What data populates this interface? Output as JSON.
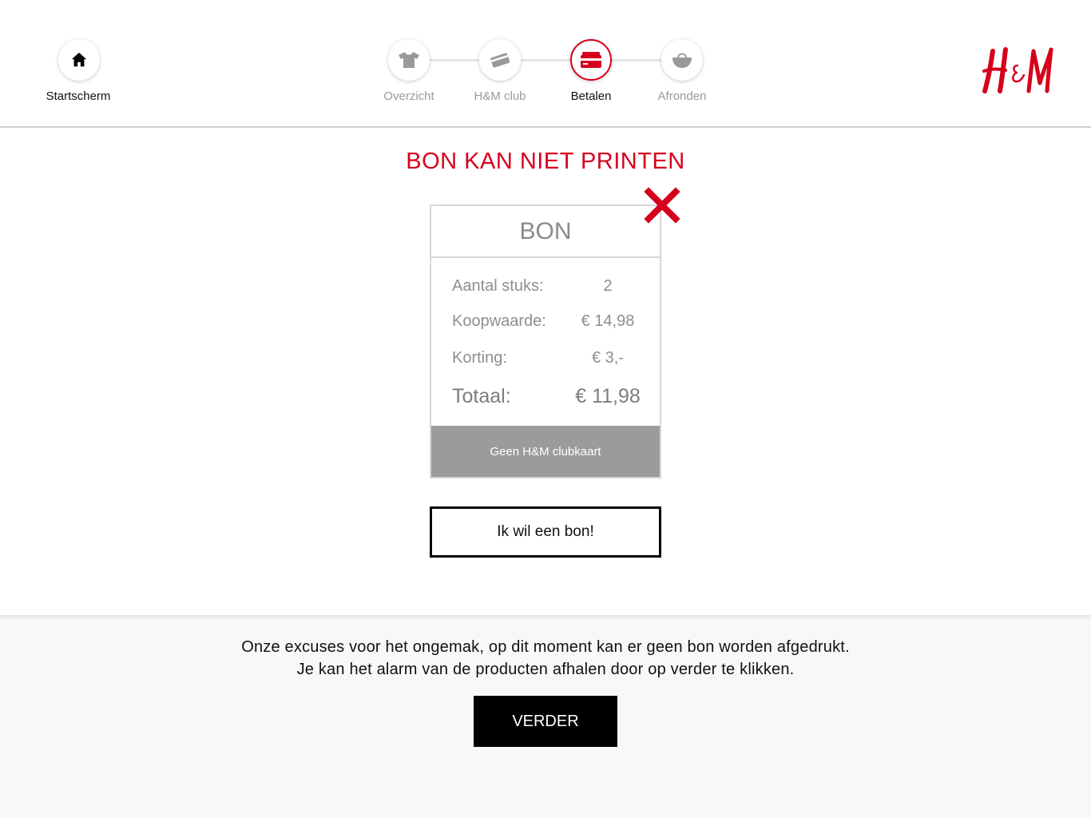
{
  "nav": {
    "home": {
      "label": "Startscherm",
      "icon": "home-icon"
    },
    "steps": [
      {
        "label": "Overzicht",
        "icon": "tshirt-icon",
        "active": false
      },
      {
        "label": "H&M club",
        "icon": "card-icon",
        "active": false
      },
      {
        "label": "Betalen",
        "icon": "credit-card-icon",
        "active": true
      },
      {
        "label": "Afronden",
        "icon": "basket-icon",
        "active": false
      }
    ]
  },
  "brand": {
    "logo_text": "H&M",
    "color": "#d6001c"
  },
  "title": "BON KAN NIET PRINTEN",
  "receipt": {
    "heading": "BON",
    "rows": [
      {
        "label": "Aantal stuks:",
        "value": "2"
      },
      {
        "label": "Koopwaarde:",
        "value": "€ 14,98"
      },
      {
        "label": "Korting:",
        "value": "€ 3,-"
      },
      {
        "label": "Totaal:",
        "value": "€ 11,98"
      }
    ],
    "club_status": "Geen H&M clubkaart"
  },
  "want_receipt_label": "Ik wil een bon!",
  "message": {
    "line1": "Onze excuses voor het ongemak, op dit moment kan er geen bon worden afgedrukt.",
    "line2": "Je kan het alarm van de producten afhalen door op verder te klikken."
  },
  "continue_label": "VERDER"
}
